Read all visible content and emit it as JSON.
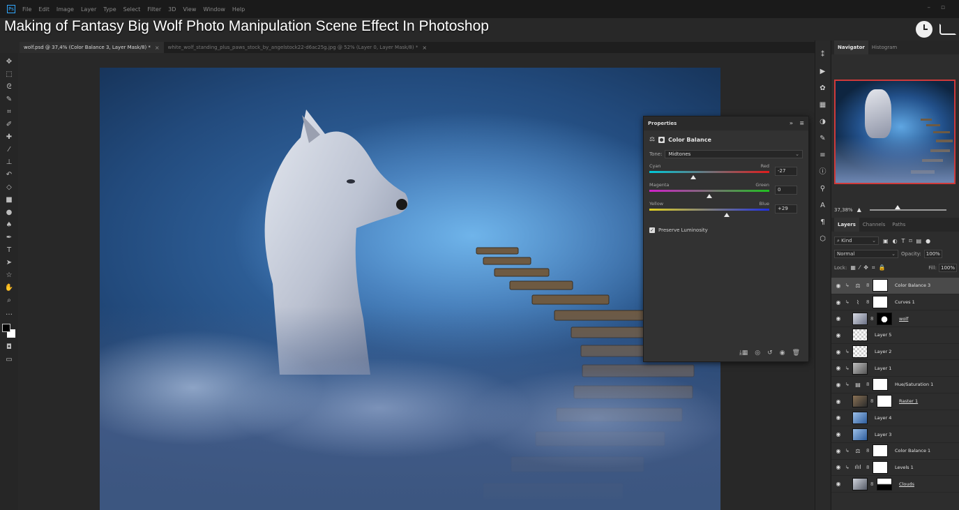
{
  "video_title": "Making of Fantasy Big Wolf Photo Manipulation Scene Effect In Photoshop",
  "menu": [
    "File",
    "Edit",
    "Image",
    "Layer",
    "Type",
    "Select",
    "Filter",
    "3D",
    "View",
    "Window",
    "Help"
  ],
  "doc_tabs": [
    {
      "label": "wolf.psd @ 37,4% (Color Balance 3, Layer Mask/8) *",
      "active": true
    },
    {
      "label": "white_wolf_standing_plus_paws_stock_by_angelstock22-d6ac25g.jpg @ 52% (Layer 0, Layer Mask/8) *",
      "active": false
    }
  ],
  "tools": [
    "move",
    "marquee",
    "lasso",
    "quick-select",
    "crop",
    "eyedropper",
    "healing",
    "brush",
    "clone-stamp",
    "history-brush",
    "eraser",
    "gradient",
    "blur",
    "dodge",
    "pen",
    "type",
    "path-select",
    "shape",
    "hand",
    "zoom",
    "more"
  ],
  "properties": {
    "panel_title": "Properties",
    "adjustment_title": "Color Balance",
    "tone_label": "Tone:",
    "tone_value": "Midtones",
    "sliders": [
      {
        "left": "Cyan",
        "right": "Red",
        "value": "-27",
        "level": -27
      },
      {
        "left": "Magenta",
        "right": "Green",
        "value": "0",
        "level": 0
      },
      {
        "left": "Yellow",
        "right": "Blue",
        "value": "+29",
        "level": 29
      }
    ],
    "preserve_luminosity": "Preserve Luminosity"
  },
  "navigator": {
    "tabs": [
      "Navigator",
      "Histogram"
    ],
    "zoom": "37,38%"
  },
  "layers_panel": {
    "tabs": [
      "Layers",
      "Channels",
      "Paths"
    ],
    "kind": "Kind",
    "blend_mode": "Normal",
    "opacity_label": "Opacity:",
    "opacity": "100%",
    "lock_label": "Lock:",
    "fill_label": "Fill:",
    "fill": "100%",
    "layers": [
      {
        "name": "Color Balance 3",
        "kind": "adj-cb",
        "clip": true,
        "selected": true,
        "underline": false
      },
      {
        "name": "Curves 1",
        "kind": "adj-curves",
        "clip": true,
        "selected": false,
        "underline": false
      },
      {
        "name": "wolf",
        "kind": "image-wolf",
        "clip": false,
        "selected": false,
        "underline": true
      },
      {
        "name": "Layer 5",
        "kind": "checker",
        "clip": false,
        "selected": false,
        "underline": false
      },
      {
        "name": "Layer 2",
        "kind": "checker",
        "clip": true,
        "selected": false,
        "underline": false
      },
      {
        "name": "Layer 1",
        "kind": "image-gray",
        "clip": true,
        "selected": false,
        "underline": false
      },
      {
        "name": "Hue/Saturation 1",
        "kind": "adj-hue",
        "clip": true,
        "selected": false,
        "underline": false
      },
      {
        "name": "Raster 1",
        "kind": "image-stairs",
        "clip": false,
        "selected": false,
        "underline": true
      },
      {
        "name": "Layer 4",
        "kind": "image-blue",
        "clip": false,
        "selected": false,
        "underline": false
      },
      {
        "name": "Layer 3",
        "kind": "image-blue",
        "clip": false,
        "selected": false,
        "underline": false
      },
      {
        "name": "Color Balance 1",
        "kind": "adj-cb",
        "clip": true,
        "selected": false,
        "underline": false
      },
      {
        "name": "Levels 1",
        "kind": "adj-levels",
        "clip": true,
        "selected": false,
        "underline": false
      },
      {
        "name": "Clouds",
        "kind": "image-clouds",
        "clip": false,
        "selected": false,
        "underline": true
      }
    ]
  },
  "colors": {
    "accent": "#31a8ff",
    "nav_frame": "#d03a3a"
  }
}
